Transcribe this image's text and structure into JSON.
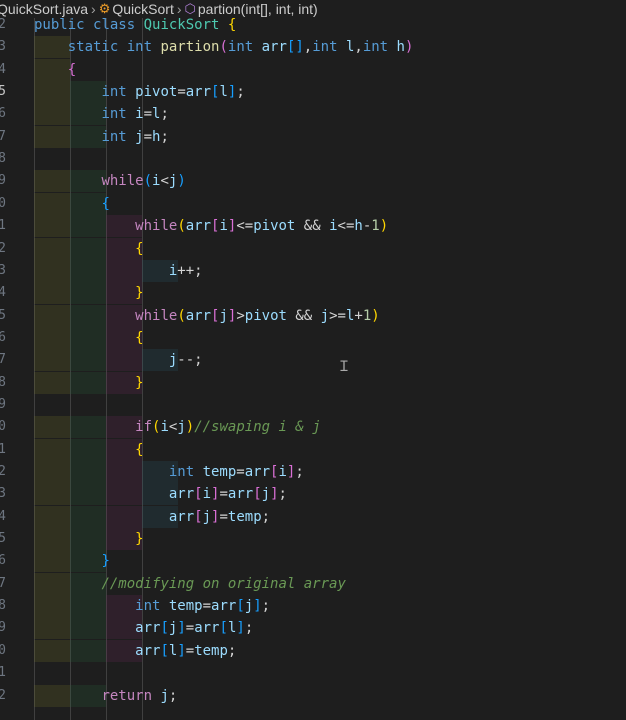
{
  "breadcrumb": {
    "file": "QuickSort.java",
    "class_name": "QuickSort",
    "method": "partion(int[], int, int)",
    "class_icon": "class-icon",
    "method_icon": "method-cube-icon"
  },
  "colors": {
    "keyword": "#569cd6",
    "control": "#c586c0",
    "type": "#4ec9b0",
    "function": "#dcdcaa",
    "variable": "#9cdcfe",
    "comment": "#6a9955",
    "number": "#b5cea8",
    "bracket_yellow": "#ffd700",
    "bracket_pink": "#da70d6",
    "bracket_blue": "#179fff",
    "text": "#d4d4d4"
  },
  "line_numbers": [
    "2",
    "3",
    "4",
    "5",
    "6",
    "7",
    "8",
    "9",
    "0",
    "1",
    "2",
    "3",
    "4",
    "5",
    "6",
    "7",
    "8",
    "9",
    "0",
    "1",
    "2",
    "3",
    "4",
    "5",
    "6",
    "7",
    "8",
    "9",
    "0",
    "1",
    "2"
  ],
  "code": [
    [
      {
        "t": "public ",
        "c": "k"
      },
      {
        "t": "class ",
        "c": "k"
      },
      {
        "t": "QuickSort ",
        "c": "ty"
      },
      {
        "t": "{",
        "c": "by"
      }
    ],
    [
      {
        "t": "    "
      },
      {
        "t": "static ",
        "c": "k"
      },
      {
        "t": "int ",
        "c": "k"
      },
      {
        "t": "partion",
        "c": "f"
      },
      {
        "t": "(",
        "c": "bp"
      },
      {
        "t": "int ",
        "c": "k"
      },
      {
        "t": "arr",
        "c": "v"
      },
      {
        "t": "[]",
        "c": "bb"
      },
      {
        "t": ","
      },
      {
        "t": "int ",
        "c": "k"
      },
      {
        "t": "l",
        "c": "v"
      },
      {
        "t": ","
      },
      {
        "t": "int ",
        "c": "k"
      },
      {
        "t": "h",
        "c": "v"
      },
      {
        "t": ")",
        "c": "bp"
      }
    ],
    [
      {
        "t": "    "
      },
      {
        "t": "{",
        "c": "bp"
      }
    ],
    [
      {
        "t": "        "
      },
      {
        "t": "int ",
        "c": "k"
      },
      {
        "t": "pivot",
        "c": "v"
      },
      {
        "t": "="
      },
      {
        "t": "arr",
        "c": "v"
      },
      {
        "t": "[",
        "c": "bb"
      },
      {
        "t": "l",
        "c": "v"
      },
      {
        "t": "]",
        "c": "bb"
      },
      {
        "t": ";"
      }
    ],
    [
      {
        "t": "        "
      },
      {
        "t": "int ",
        "c": "k"
      },
      {
        "t": "i",
        "c": "v"
      },
      {
        "t": "="
      },
      {
        "t": "l",
        "c": "v"
      },
      {
        "t": ";"
      }
    ],
    [
      {
        "t": "        "
      },
      {
        "t": "int ",
        "c": "k"
      },
      {
        "t": "j",
        "c": "v"
      },
      {
        "t": "="
      },
      {
        "t": "h",
        "c": "v"
      },
      {
        "t": ";"
      }
    ],
    [],
    [
      {
        "t": "        "
      },
      {
        "t": "while",
        "c": "ct"
      },
      {
        "t": "(",
        "c": "bb"
      },
      {
        "t": "i",
        "c": "v"
      },
      {
        "t": "<"
      },
      {
        "t": "j",
        "c": "v"
      },
      {
        "t": ")",
        "c": "bb"
      }
    ],
    [
      {
        "t": "        "
      },
      {
        "t": "{",
        "c": "bb"
      }
    ],
    [
      {
        "t": "            "
      },
      {
        "t": "while",
        "c": "ct"
      },
      {
        "t": "(",
        "c": "by"
      },
      {
        "t": "arr",
        "c": "v"
      },
      {
        "t": "[",
        "c": "bp"
      },
      {
        "t": "i",
        "c": "v"
      },
      {
        "t": "]",
        "c": "bp"
      },
      {
        "t": "<="
      },
      {
        "t": "pivot",
        "c": "v"
      },
      {
        "t": " && "
      },
      {
        "t": "i",
        "c": "v"
      },
      {
        "t": "<="
      },
      {
        "t": "h",
        "c": "v"
      },
      {
        "t": "-"
      },
      {
        "t": "1",
        "c": "n"
      },
      {
        "t": ")",
        "c": "by"
      }
    ],
    [
      {
        "t": "            "
      },
      {
        "t": "{",
        "c": "by"
      }
    ],
    [
      {
        "t": "                "
      },
      {
        "t": "i",
        "c": "v"
      },
      {
        "t": "++;"
      }
    ],
    [
      {
        "t": "            "
      },
      {
        "t": "}",
        "c": "by"
      }
    ],
    [
      {
        "t": "            "
      },
      {
        "t": "while",
        "c": "ct"
      },
      {
        "t": "(",
        "c": "by"
      },
      {
        "t": "arr",
        "c": "v"
      },
      {
        "t": "[",
        "c": "bp"
      },
      {
        "t": "j",
        "c": "v"
      },
      {
        "t": "]",
        "c": "bp"
      },
      {
        "t": ">"
      },
      {
        "t": "pivot",
        "c": "v"
      },
      {
        "t": " && "
      },
      {
        "t": "j",
        "c": "v"
      },
      {
        "t": ">="
      },
      {
        "t": "l",
        "c": "v"
      },
      {
        "t": "+"
      },
      {
        "t": "1",
        "c": "n"
      },
      {
        "t": ")",
        "c": "by"
      }
    ],
    [
      {
        "t": "            "
      },
      {
        "t": "{",
        "c": "by"
      }
    ],
    [
      {
        "t": "                "
      },
      {
        "t": "j",
        "c": "v"
      },
      {
        "t": "--;"
      }
    ],
    [
      {
        "t": "            "
      },
      {
        "t": "}",
        "c": "by"
      }
    ],
    [],
    [
      {
        "t": "            "
      },
      {
        "t": "if",
        "c": "ct"
      },
      {
        "t": "(",
        "c": "by"
      },
      {
        "t": "i",
        "c": "v"
      },
      {
        "t": "<"
      },
      {
        "t": "j",
        "c": "v"
      },
      {
        "t": ")",
        "c": "by"
      },
      {
        "t": "//swaping i & j",
        "c": "cm"
      }
    ],
    [
      {
        "t": "            "
      },
      {
        "t": "{",
        "c": "by"
      }
    ],
    [
      {
        "t": "                "
      },
      {
        "t": "int ",
        "c": "k"
      },
      {
        "t": "temp",
        "c": "v"
      },
      {
        "t": "="
      },
      {
        "t": "arr",
        "c": "v"
      },
      {
        "t": "[",
        "c": "bp"
      },
      {
        "t": "i",
        "c": "v"
      },
      {
        "t": "]",
        "c": "bp"
      },
      {
        "t": ";"
      }
    ],
    [
      {
        "t": "                "
      },
      {
        "t": "arr",
        "c": "v"
      },
      {
        "t": "[",
        "c": "bp"
      },
      {
        "t": "i",
        "c": "v"
      },
      {
        "t": "]",
        "c": "bp"
      },
      {
        "t": "="
      },
      {
        "t": "arr",
        "c": "v"
      },
      {
        "t": "[",
        "c": "bp"
      },
      {
        "t": "j",
        "c": "v"
      },
      {
        "t": "]",
        "c": "bp"
      },
      {
        "t": ";"
      }
    ],
    [
      {
        "t": "                "
      },
      {
        "t": "arr",
        "c": "v"
      },
      {
        "t": "[",
        "c": "bp"
      },
      {
        "t": "j",
        "c": "v"
      },
      {
        "t": "]",
        "c": "bp"
      },
      {
        "t": "="
      },
      {
        "t": "temp",
        "c": "v"
      },
      {
        "t": ";"
      }
    ],
    [
      {
        "t": "            "
      },
      {
        "t": "}",
        "c": "by"
      }
    ],
    [
      {
        "t": "        "
      },
      {
        "t": "}",
        "c": "bb"
      }
    ],
    [
      {
        "t": "        "
      },
      {
        "t": "//modifying on original array",
        "c": "cm"
      }
    ],
    [
      {
        "t": "            "
      },
      {
        "t": "int ",
        "c": "k"
      },
      {
        "t": "temp",
        "c": "v"
      },
      {
        "t": "="
      },
      {
        "t": "arr",
        "c": "v"
      },
      {
        "t": "[",
        "c": "bb"
      },
      {
        "t": "j",
        "c": "v"
      },
      {
        "t": "]",
        "c": "bb"
      },
      {
        "t": ";"
      }
    ],
    [
      {
        "t": "            "
      },
      {
        "t": "arr",
        "c": "v"
      },
      {
        "t": "[",
        "c": "bb"
      },
      {
        "t": "j",
        "c": "v"
      },
      {
        "t": "]",
        "c": "bb"
      },
      {
        "t": "="
      },
      {
        "t": "arr",
        "c": "v"
      },
      {
        "t": "[",
        "c": "bb"
      },
      {
        "t": "l",
        "c": "v"
      },
      {
        "t": "]",
        "c": "bb"
      },
      {
        "t": ";"
      }
    ],
    [
      {
        "t": "            "
      },
      {
        "t": "arr",
        "c": "v"
      },
      {
        "t": "[",
        "c": "bb"
      },
      {
        "t": "l",
        "c": "v"
      },
      {
        "t": "]",
        "c": "bb"
      },
      {
        "t": "="
      },
      {
        "t": "temp",
        "c": "v"
      },
      {
        "t": ";"
      }
    ],
    [],
    [
      {
        "t": "        "
      },
      {
        "t": "return ",
        "c": "ct"
      },
      {
        "t": "j",
        "c": "v"
      },
      {
        "t": ";"
      }
    ]
  ]
}
